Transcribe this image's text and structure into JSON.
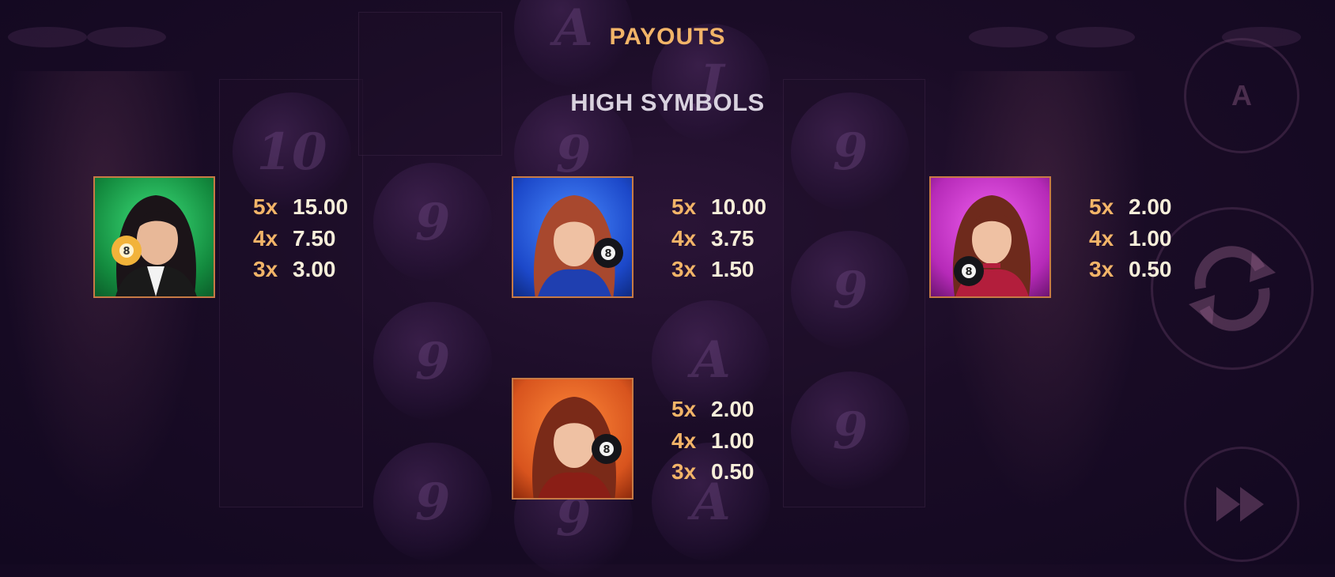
{
  "screen": {
    "title": "PAYOUTS",
    "section_title": "HIGH SYMBOLS"
  },
  "symbols": [
    {
      "name": "green-lady",
      "icon": "lady-with-yellow-8-ball-icon",
      "background_color": "#1ea552",
      "payouts": [
        {
          "mult": "5x",
          "value": "15.00"
        },
        {
          "mult": "4x",
          "value": "7.50"
        },
        {
          "mult": "3x",
          "value": "3.00"
        }
      ]
    },
    {
      "name": "blue-lady",
      "icon": "lady-with-black-8-ball-icon",
      "background_color": "#1c48c9",
      "payouts": [
        {
          "mult": "5x",
          "value": "10.00"
        },
        {
          "mult": "4x",
          "value": "3.75"
        },
        {
          "mult": "3x",
          "value": "1.50"
        }
      ]
    },
    {
      "name": "pink-lady",
      "icon": "lady-with-black-8-ball-icon",
      "background_color": "#c22fc9",
      "payouts": [
        {
          "mult": "5x",
          "value": "2.00"
        },
        {
          "mult": "4x",
          "value": "1.00"
        },
        {
          "mult": "3x",
          "value": "0.50"
        }
      ]
    },
    {
      "name": "orange-lady",
      "icon": "lady-with-black-8-ball-icon",
      "background_color": "#d8541e",
      "payouts": [
        {
          "mult": "5x",
          "value": "2.00"
        },
        {
          "mult": "4x",
          "value": "1.00"
        },
        {
          "mult": "3x",
          "value": "0.50"
        }
      ]
    }
  ],
  "background": {
    "ball_labels": [
      "10",
      "9",
      "9",
      "9",
      "A",
      "9",
      "9",
      "A",
      "J",
      "9",
      "9",
      "9",
      "A"
    ],
    "buttons": {
      "autoplay_icon": "autoplay-icon",
      "autoplay_label": "A",
      "spin_icon": "spin-arrows-icon",
      "turbo_icon": "fast-forward-icon"
    }
  }
}
